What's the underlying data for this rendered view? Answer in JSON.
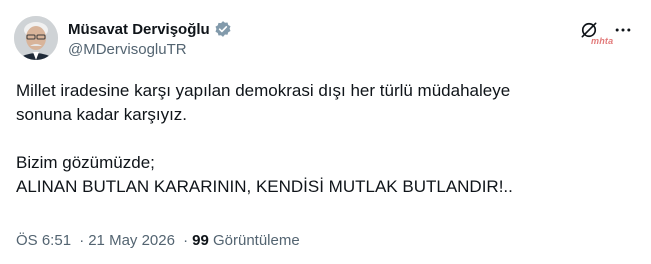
{
  "author": {
    "display_name": "Müsavat Dervişoğlu",
    "handle": "@MDervisogluTR"
  },
  "icons": {
    "verified": "verified-badge-icon",
    "grok": "grok-icon",
    "more": "more-options-icon"
  },
  "watermark": "mhta",
  "tweet": {
    "lines": [
      "Millet iradesine karşı yapılan demokrasi dışı her türlü müdahaleye",
      "sonuna kadar karşıyız.",
      "Bizim gözümüzde;",
      "ALINAN BUTLAN KARARININ, KENDİSİ MUTLAK BUTLANDIR!.."
    ]
  },
  "meta": {
    "time": "ÖS 6:51",
    "separator": "·",
    "date": "21 May 2026",
    "views_count": "99",
    "views_label": "Görüntüleme"
  },
  "colors": {
    "text": "#0f1419",
    "secondary": "#536471",
    "verified": "#829aab"
  }
}
